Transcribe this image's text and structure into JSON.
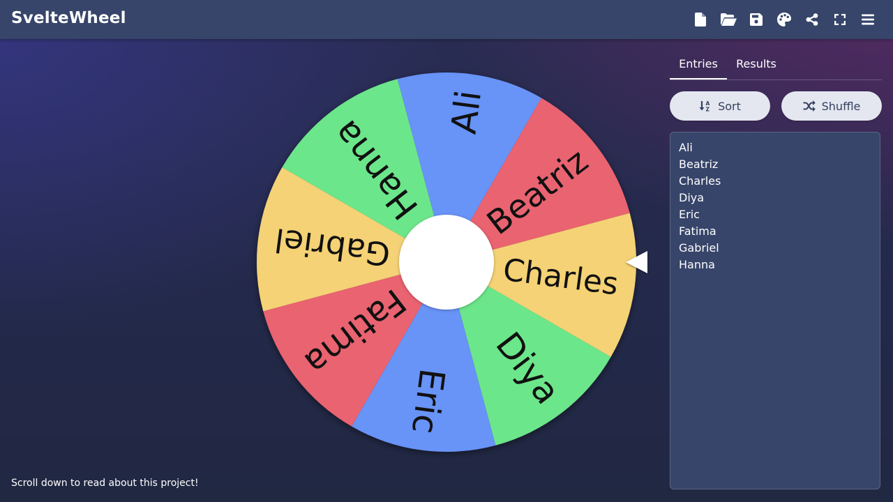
{
  "header": {
    "title": "SvelteWheel",
    "actions": [
      {
        "name": "new-file",
        "icon": "file-icon"
      },
      {
        "name": "open",
        "icon": "folder-open-icon"
      },
      {
        "name": "save",
        "icon": "floppy-disk-icon"
      },
      {
        "name": "customize",
        "icon": "palette-icon"
      },
      {
        "name": "share",
        "icon": "share-icon"
      },
      {
        "name": "fullscreen",
        "icon": "expand-icon"
      },
      {
        "name": "menu",
        "icon": "hamburger-icon"
      }
    ]
  },
  "wheel": {
    "segments": [
      {
        "label": "Ali",
        "color": "#6793f7"
      },
      {
        "label": "Beatriz",
        "color": "#e9636f"
      },
      {
        "label": "Charles",
        "color": "#f4d274"
      },
      {
        "label": "Diya",
        "color": "#6ce68a"
      },
      {
        "label": "Eric",
        "color": "#6793f7"
      },
      {
        "label": "Fatima",
        "color": "#e9636f"
      },
      {
        "label": "Gabriel",
        "color": "#f4d274"
      },
      {
        "label": "Hanna",
        "color": "#6ce68a"
      }
    ],
    "hub_color": "#ffffff",
    "pointer_color": "#ffffff"
  },
  "sidebar": {
    "tabs": [
      {
        "label": "Entries",
        "active": true
      },
      {
        "label": "Results",
        "active": false
      }
    ],
    "sort_label": "Sort",
    "shuffle_label": "Shuffle",
    "entries": [
      "Ali",
      "Beatriz",
      "Charles",
      "Diya",
      "Eric",
      "Fatima",
      "Gabriel",
      "Hanna"
    ]
  },
  "footer": {
    "note": "Scroll down to read about this project!"
  }
}
